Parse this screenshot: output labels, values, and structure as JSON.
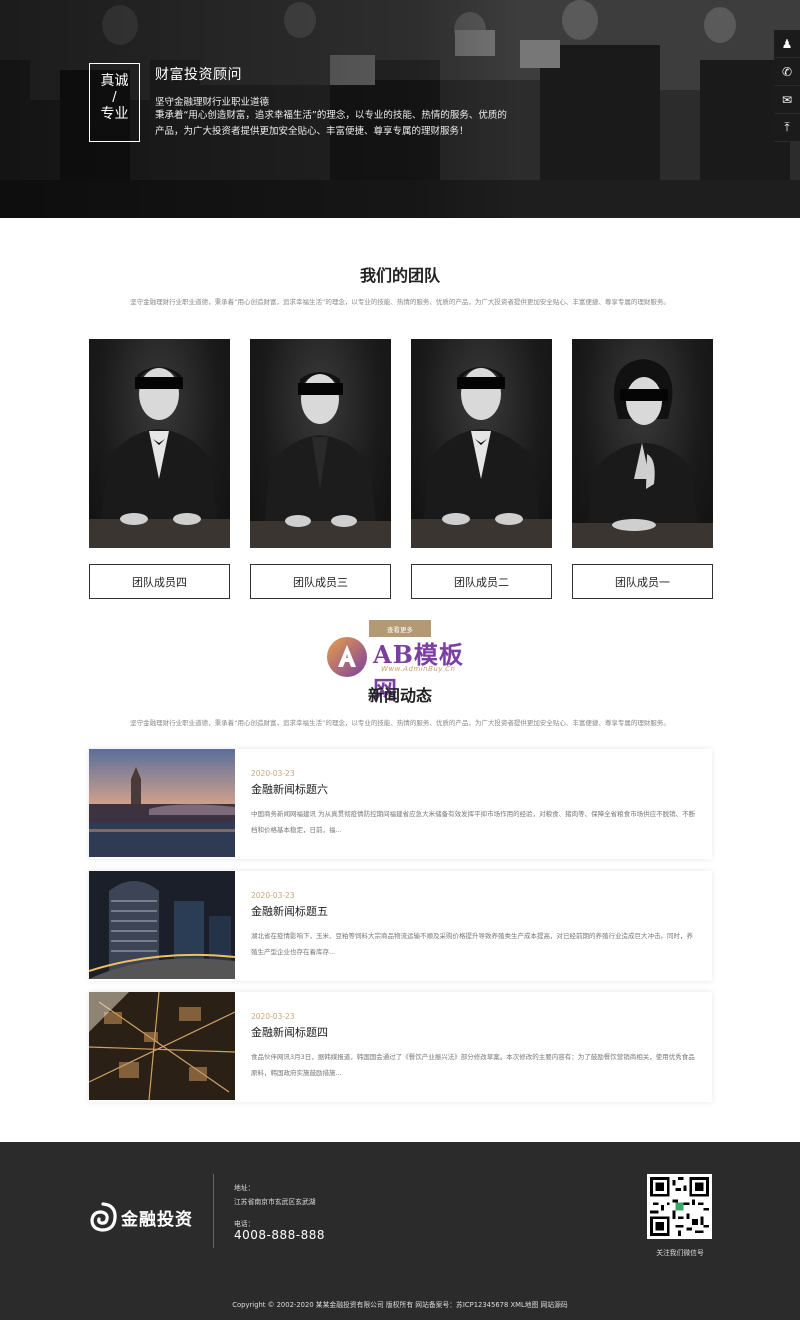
{
  "hero": {
    "badge_top": "真诚",
    "badge_slash": "/",
    "badge_bottom": "专业",
    "title": "财富投资顾问",
    "subtitle": "坚守金融理财行业职业道德",
    "description": "秉承着“用心创造财富，追求幸福生活”的理念，以专业的技能、热情的服务、优质的产品，为广大投资者提供更加安全贴心、丰富便捷、尊享专属的理财服务！"
  },
  "side_tools": [
    {
      "icon": "qq-icon",
      "glyph": "♟"
    },
    {
      "icon": "phone-icon",
      "glyph": "✆"
    },
    {
      "icon": "wechat-icon",
      "glyph": "✉"
    },
    {
      "icon": "back-to-top-icon",
      "glyph": "⤒"
    }
  ],
  "team": {
    "title": "我们的团队",
    "description": "坚守金融理财行业职业道德，秉承着“用心创造财富，追求幸福生活”的理念，以专业的技能、热情的服务、优质的产品，为广大投资者提供更加安全贴心、丰富便捷、尊享专属的理财服务。",
    "members": [
      {
        "name": "团队成员四"
      },
      {
        "name": "团队成员三"
      },
      {
        "name": "团队成员二"
      },
      {
        "name": "团队成员一"
      }
    ]
  },
  "more_label": "查看更多",
  "watermark": {
    "text": "AB模板网",
    "url": "Www.AdminBuy.Cn"
  },
  "news": {
    "title": "新闻动态",
    "description": "坚守金融理财行业职业道德，秉承着“用心创造财富，追求幸福生活”的理念，以专业的技能、热情的服务、优质的产品，为广大投资者提供更加安全贴心、丰富便捷、尊享专属的理财服务。",
    "items": [
      {
        "date": "2020-03-23",
        "title": "金融新闻标题六",
        "summary": "中国商务新闻网福建讯 为从真贯彻疫情防控期间福建省应急大米储备有效发挥平抑市场作用的经验，对粮食、猪肉等、保障全省粮食市场供应不脱销、不断档和价格基本稳定，日前，福..."
      },
      {
        "date": "2020-03-23",
        "title": "金融新闻标题五",
        "summary": "湖北省在疫情影响下，玉米、豆粕等饲料大宗商品物流运输不顺及采购价格提升导致养殖类生产成本提高，对已经前期的养殖行业造成巨大冲击。同时，养殖生产型企业也存在着库存..."
      },
      {
        "date": "2020-03-23",
        "title": "金融新闻标题四",
        "summary": "食品伙伴网讯3月3日，据韩媒报道，韩国国会通过了《餐饮产业振兴法》部分修改草案。本次修改的主要内容有：为了鼓励餐饮营销商相关，使用优秀食品原料，韩国政府实施鼓励措施..."
      }
    ]
  },
  "footer": {
    "logo_text": "金融投资",
    "address_label": "地址：",
    "address": "江苏省南京市玄武区玄武湖",
    "phone_label": "电话：",
    "phone": "4008-888-888",
    "qr_caption": "关注我们微信号",
    "copyright": "Copyright © 2002-2020 某某金融投资有限公司 版权所有 网站备案号：苏ICP12345678 XML地图 网站源码"
  },
  "colors": {
    "accent": "#b49a74",
    "date": "#c9a97a",
    "footer_bg": "#2b2b2b",
    "watermark": "#7b3fa0"
  }
}
